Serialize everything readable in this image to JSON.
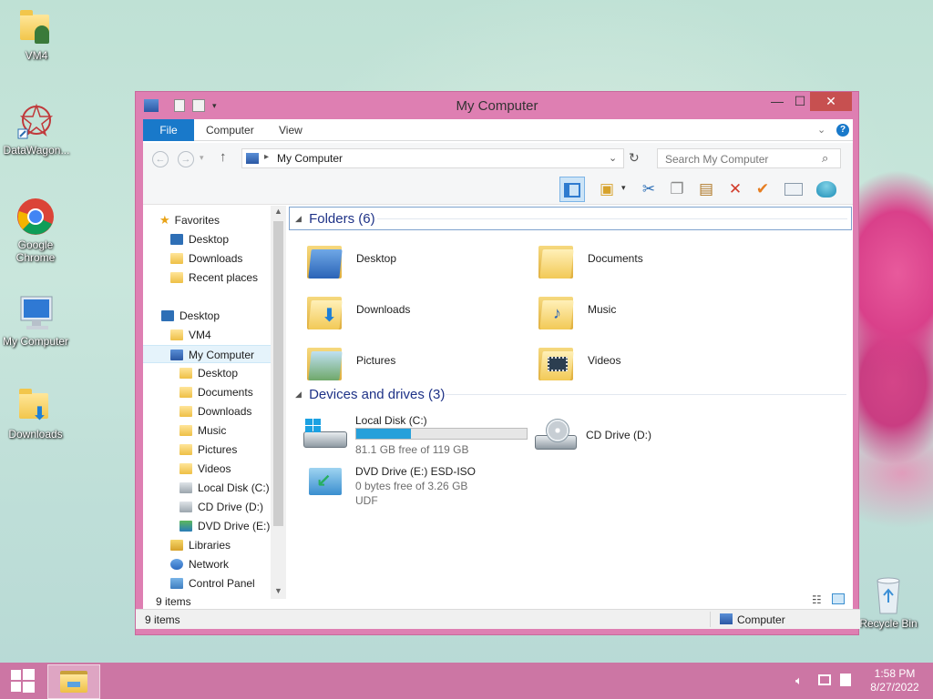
{
  "desktop": {
    "icons": [
      {
        "label": "VM4",
        "icon": "user-folder-icon"
      },
      {
        "label": "DataWagon...",
        "icon": "datawagon-icon"
      },
      {
        "label": "Google Chrome",
        "icon": "chrome-icon"
      },
      {
        "label": "My Computer",
        "icon": "computer-icon"
      },
      {
        "label": "Downloads",
        "icon": "downloads-folder-icon"
      },
      {
        "label": "Recycle Bin",
        "icon": "recycle-bin-icon"
      }
    ]
  },
  "window": {
    "title": "My Computer",
    "minimize": "—",
    "maximize": "☐",
    "close": "✕",
    "tabs": {
      "file": "File",
      "computer": "Computer",
      "view": "View"
    },
    "help": "?",
    "address": {
      "location": "My Computer"
    },
    "search": {
      "placeholder": "Search My Computer"
    }
  },
  "nav": {
    "items": [
      {
        "label": "Favorites",
        "icon": "star-icon"
      },
      {
        "label": "Desktop",
        "icon": "desktop-icon"
      },
      {
        "label": "Downloads",
        "icon": "downloads-icon"
      },
      {
        "label": "Recent places",
        "icon": "recent-places-icon"
      },
      {
        "label": "Desktop",
        "icon": "desktop-icon"
      },
      {
        "label": "VM4",
        "icon": "user-folder-icon"
      },
      {
        "label": "My Computer",
        "icon": "computer-icon"
      },
      {
        "label": "Desktop",
        "icon": "folder-icon"
      },
      {
        "label": "Documents",
        "icon": "folder-icon"
      },
      {
        "label": "Downloads",
        "icon": "folder-icon"
      },
      {
        "label": "Music",
        "icon": "folder-icon"
      },
      {
        "label": "Pictures",
        "icon": "folder-icon"
      },
      {
        "label": "Videos",
        "icon": "folder-icon"
      },
      {
        "label": "Local Disk (C:)",
        "icon": "drive-icon"
      },
      {
        "label": "CD Drive (D:)",
        "icon": "cd-drive-icon"
      },
      {
        "label": "DVD Drive (E:) E",
        "icon": "dvd-drive-icon"
      },
      {
        "label": "Libraries",
        "icon": "libraries-icon"
      },
      {
        "label": "Network",
        "icon": "network-icon"
      },
      {
        "label": "Control Panel",
        "icon": "control-panel-icon"
      }
    ]
  },
  "main": {
    "folders_header": "Folders (6)",
    "folders": [
      {
        "label": "Desktop"
      },
      {
        "label": "Documents"
      },
      {
        "label": "Downloads"
      },
      {
        "label": "Music"
      },
      {
        "label": "Pictures"
      },
      {
        "label": "Videos"
      }
    ],
    "drives_header": "Devices and drives (3)",
    "drives": [
      {
        "label": "Local Disk (C:)",
        "free": "81.1 GB free of 119 GB",
        "used_fraction": 0.32
      },
      {
        "label": "CD Drive (D:)"
      },
      {
        "label": "DVD Drive (E:) ESD-ISO",
        "free": "0 bytes free of 3.26 GB",
        "fs": "UDF"
      }
    ]
  },
  "status": {
    "inner_count": "9 items",
    "count": "9 items",
    "location": "Computer"
  },
  "taskbar": {
    "time": "1:58 PM",
    "date": "8/27/2022"
  },
  "colors": {
    "accent": "#1979ca",
    "window_frame": "#de7fb2",
    "close": "#c75050",
    "disk_bar": "#26a0da"
  }
}
